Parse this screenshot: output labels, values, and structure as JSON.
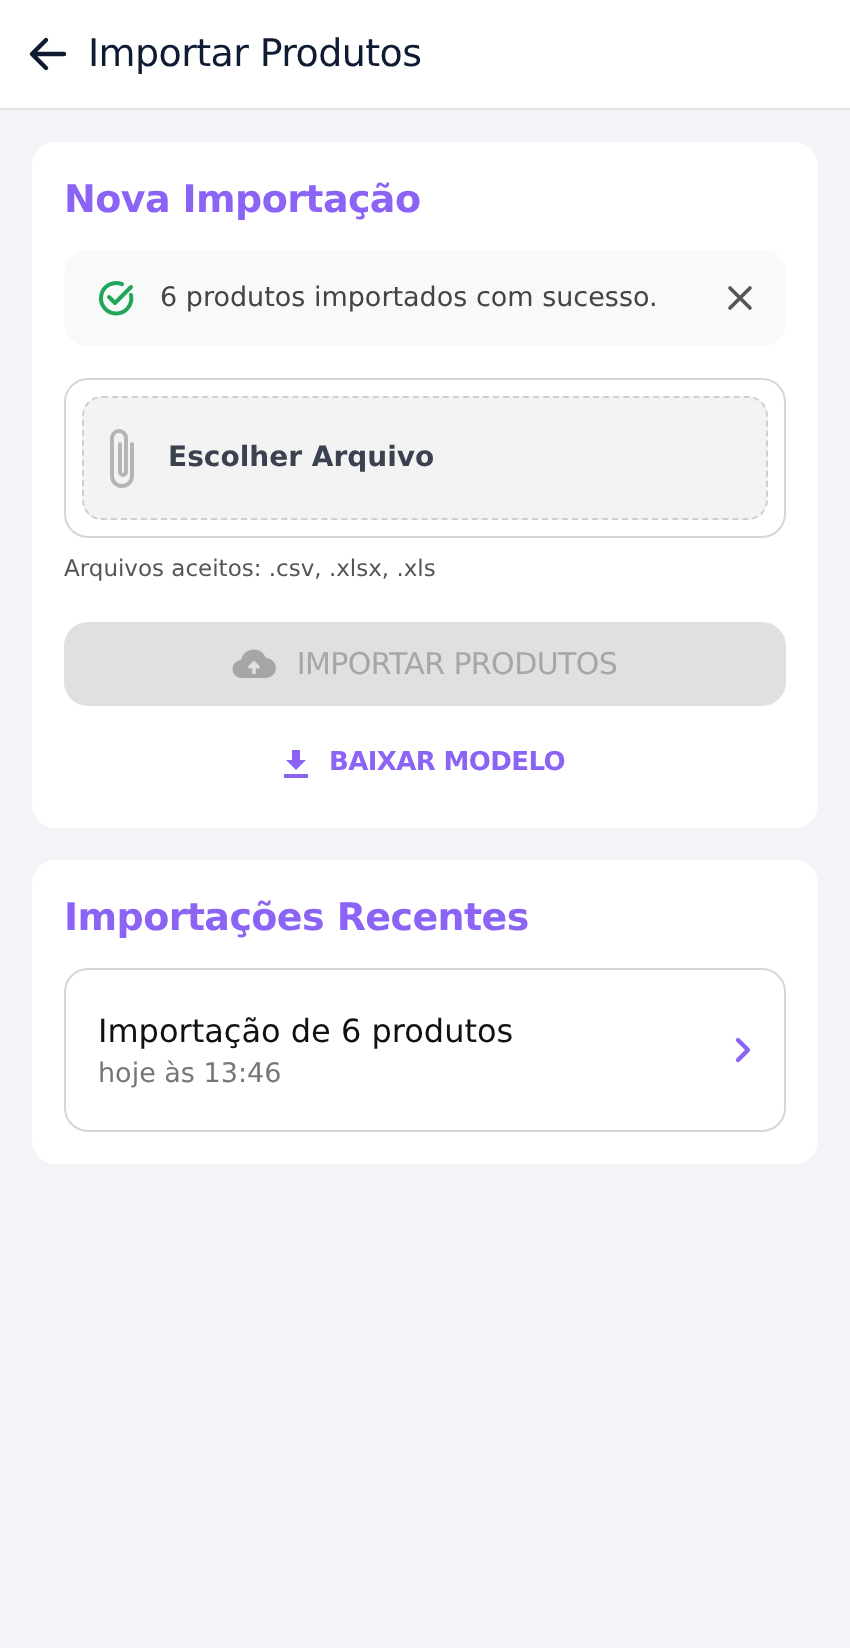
{
  "header": {
    "title": "Importar Produtos"
  },
  "new_import": {
    "title": "Nova Importação",
    "alert": {
      "kind": "success",
      "message": "6 produtos importados com sucesso."
    },
    "file_picker": {
      "label": "Escolher Arquivo"
    },
    "hint": "Arquivos aceitos: .csv, .xlsx, .xls",
    "import_button": {
      "label": "IMPORTAR PRODUTOS",
      "disabled": true
    },
    "template_link": {
      "label": "BAIXAR MODELO"
    }
  },
  "recent": {
    "title": "Importações Recentes",
    "items": [
      {
        "title": "Importação de 6 produtos",
        "time": "hoje às 13:46"
      }
    ]
  }
}
